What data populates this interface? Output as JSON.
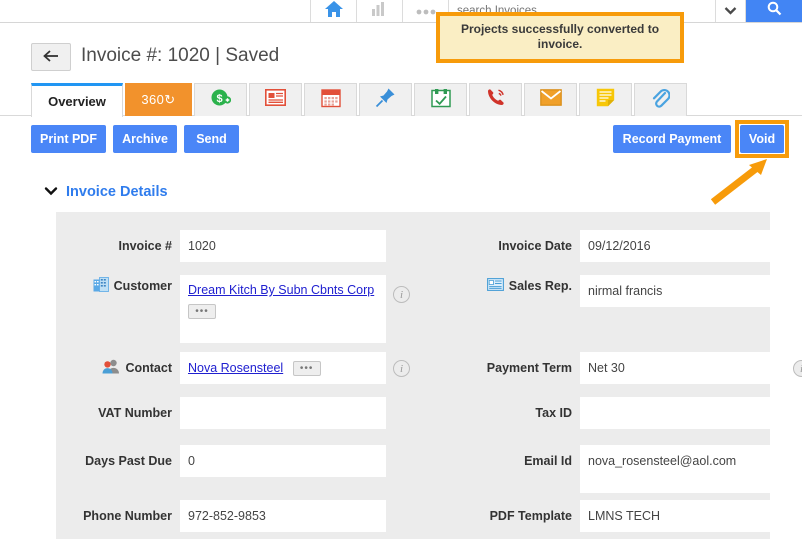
{
  "topbar": {
    "home_icon": "home-icon",
    "chart_icon": "bar-chart-icon",
    "more_icon": "more-dots-icon",
    "search_placeholder": "search Invoices",
    "search_value": "",
    "caret_icon": "chevron-down-icon",
    "search_button_icon": "search-icon",
    "accent": "#4285f4"
  },
  "notification": {
    "message": "Projects successfully converted to invoice.",
    "bg": "#faeec4",
    "border": "#f79b0a"
  },
  "header": {
    "back_icon": "arrow-left-icon",
    "title": "Invoice #: 1020 | Saved"
  },
  "tabs": [
    {
      "label": "Overview",
      "icon": "",
      "active": true,
      "name": "tab-overview"
    },
    {
      "label": "360",
      "icon": "refresh-360-icon",
      "active": false,
      "name": "tab-360"
    },
    {
      "label": "",
      "icon": "dollar-money-icon",
      "active": false,
      "name": "tab-payments"
    },
    {
      "label": "",
      "icon": "document-lines-icon",
      "active": false,
      "name": "tab-notes"
    },
    {
      "label": "",
      "icon": "calendar-icon",
      "active": false,
      "name": "tab-calendar"
    },
    {
      "label": "",
      "icon": "pin-icon",
      "active": false,
      "name": "tab-pinned"
    },
    {
      "label": "",
      "icon": "task-check-icon",
      "active": false,
      "name": "tab-tasks"
    },
    {
      "label": "",
      "icon": "phone-call-icon",
      "active": false,
      "name": "tab-calls"
    },
    {
      "label": "",
      "icon": "envelope-icon",
      "active": false,
      "name": "tab-emails"
    },
    {
      "label": "",
      "icon": "sticky-note-icon",
      "active": false,
      "name": "tab-notes2"
    },
    {
      "label": "",
      "icon": "paperclip-icon",
      "active": false,
      "name": "tab-attachments"
    }
  ],
  "actions": {
    "print_pdf": "Print PDF",
    "archive": "Archive",
    "send": "Send",
    "record_payment": "Record Payment",
    "void": "Void",
    "button_color": "#4a86f7",
    "highlight_color": "#f79b0a"
  },
  "section": {
    "chevron_icon": "chevron-down-icon",
    "title": "Invoice Details",
    "title_color": "#2f7ced"
  },
  "form": {
    "rows": [
      {
        "left": {
          "label": "Invoice #",
          "value": "1020",
          "icon": "",
          "info": false,
          "name": "invoice-number"
        },
        "right": {
          "label": "Invoice Date",
          "value": "09/12/2016",
          "icon": "",
          "info": false,
          "name": "invoice-date"
        }
      },
      {
        "left": {
          "label": "Customer",
          "value": "Dream Kitch By Subn Cbnts Corp",
          "icon": "building-icon",
          "link": true,
          "more": true,
          "info": true,
          "name": "customer"
        },
        "right": {
          "label": "Sales Rep.",
          "value": "nirmal francis",
          "icon": "contact-card-icon",
          "info": false,
          "name": "sales-rep"
        }
      },
      {
        "left": {
          "label": "Contact",
          "value": "Nova Rosensteel",
          "icon": "people-icon",
          "link": true,
          "more": true,
          "info": true,
          "name": "contact"
        },
        "right": {
          "label": "Payment Term",
          "value": "Net 30",
          "icon": "",
          "info": true,
          "name": "payment-term"
        }
      },
      {
        "left": {
          "label": "VAT Number",
          "value": "",
          "icon": "",
          "info": false,
          "name": "vat-number"
        },
        "right": {
          "label": "Tax ID",
          "value": "",
          "icon": "",
          "info": false,
          "name": "tax-id"
        }
      },
      {
        "left": {
          "label": "Days Past Due",
          "value": "0",
          "icon": "",
          "info": false,
          "name": "days-past-due"
        },
        "right": {
          "label": "Email Id",
          "value": "nova_rosensteel@aol.com",
          "icon": "",
          "info": false,
          "name": "email-id"
        }
      },
      {
        "left": {
          "label": "Phone Number",
          "value": "972-852-9853",
          "icon": "",
          "info": false,
          "name": "phone-number"
        },
        "right": {
          "label": "PDF Template",
          "value": "LMNS TECH",
          "icon": "",
          "info": false,
          "name": "pdf-template"
        }
      }
    ]
  }
}
